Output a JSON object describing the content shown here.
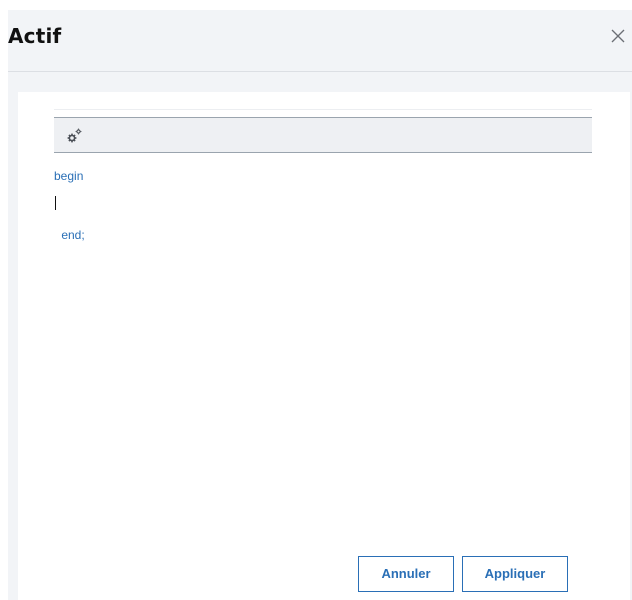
{
  "dialog": {
    "title": "Actif",
    "close_icon": "close-icon"
  },
  "editor": {
    "toolbar": {
      "settings_icon": "gears-icon"
    },
    "lines": [
      "begin",
      "",
      " end;"
    ],
    "text_color": "#2a6fb6"
  },
  "footer": {
    "cancel_label": "Annuler",
    "apply_label": "Appliquer"
  },
  "colors": {
    "accent": "#2a6fb6",
    "dialog_background": "#f2f4f7",
    "panel_background": "#ffffff",
    "toolbar_background": "#eef0f3"
  }
}
